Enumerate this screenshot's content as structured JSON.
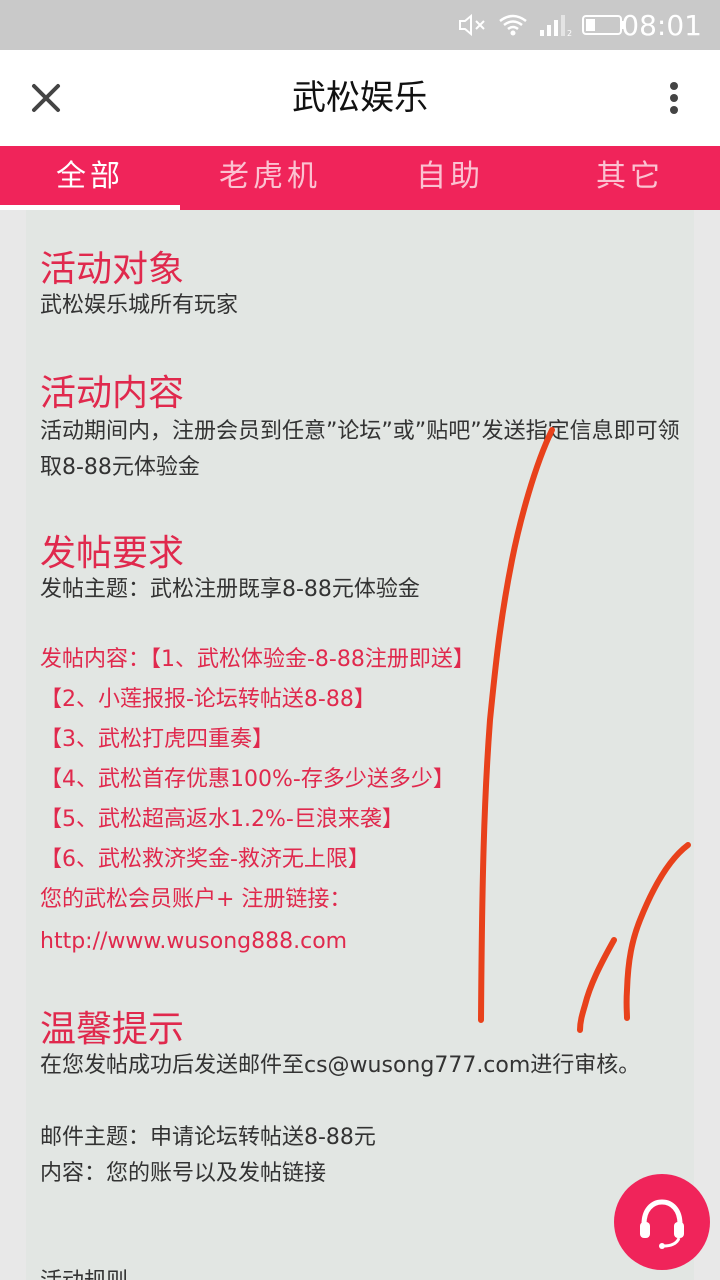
{
  "status_bar": {
    "time": "08:01",
    "icons": [
      "mute-icon",
      "wifi-icon",
      "signal-icon",
      "battery-icon"
    ]
  },
  "header": {
    "title": "武松娱乐",
    "close_icon": "close-icon",
    "more_icon": "more-vert-icon"
  },
  "tabs": [
    {
      "label": "全部",
      "active": true
    },
    {
      "label": "老虎机",
      "active": false
    },
    {
      "label": "自助",
      "active": false
    },
    {
      "label": "其它",
      "active": false
    }
  ],
  "content": {
    "target": {
      "title": "活动对象",
      "text": "武松娱乐城所有玩家"
    },
    "activity": {
      "title": "活动内容",
      "text": "活动期间内，注册会员到任意”论坛”或”贴吧”发送指定信息即可领取8-88元体验金"
    },
    "posting": {
      "title": "发帖要求",
      "subject": "发帖主题：武松注册既享8-88元体验金",
      "content_lines": [
        "发帖内容：【1、武松体验金-8-88注册即送】",
        "【2、小莲报报-论坛转帖送8-88】",
        "【3、武松打虎四重奏】",
        "【4、武松首存优惠100%-存多少送多少】",
        "【5、武松超高返水1.2%-巨浪来袭】",
        "【6、武松救济奖金-救济无上限】",
        "您的武松会员账户+ 注册链接：",
        "http://www.wusong888.com"
      ]
    },
    "tips": {
      "title": "温馨提示",
      "text": "在您发帖成功后发送邮件至cs@wusong777.com进行审核。",
      "mail_subject": "邮件主题：申请论坛转帖送8-88元",
      "mail_content": "内容：您的账号以及发帖链接"
    },
    "rules_title": "活动规则"
  },
  "colors": {
    "accent": "#f0245a",
    "heading": "#e0294d",
    "card_bg": "#e2e6e3",
    "scribble": "#e8411b"
  },
  "support_button": {
    "icon": "headset-icon"
  }
}
